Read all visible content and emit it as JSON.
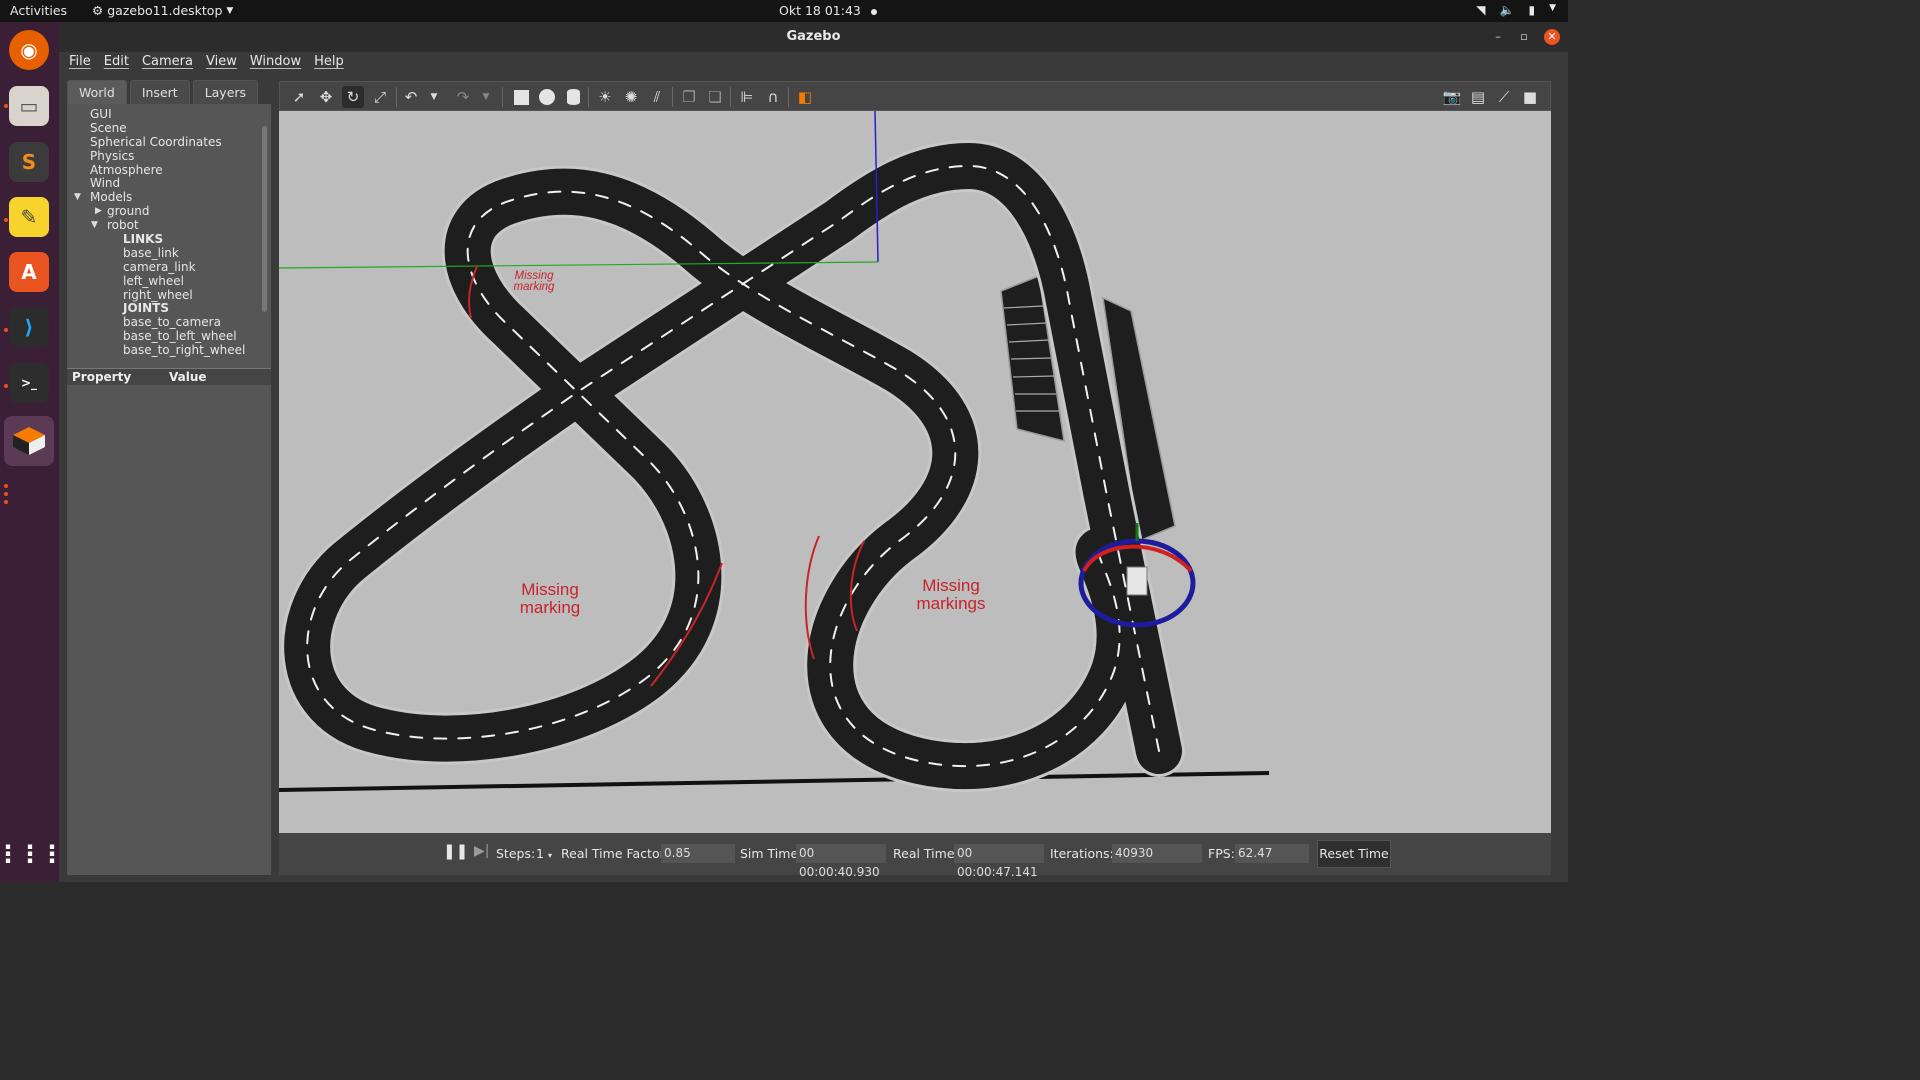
{
  "topbar": {
    "activities": "Activities",
    "app_menu": "gazebo11.desktop",
    "clock": "Okt 18  01:43"
  },
  "window": {
    "title": "Gazebo",
    "menus": [
      "File",
      "Edit",
      "Camera",
      "View",
      "Window",
      "Help"
    ]
  },
  "left_panel": {
    "tabs": [
      "World",
      "Insert",
      "Layers"
    ],
    "active_tab": "World",
    "tree": {
      "gui": "GUI",
      "scene": "Scene",
      "spherical": "Spherical Coordinates",
      "physics": "Physics",
      "atmosphere": "Atmosphere",
      "wind": "Wind",
      "models": "Models",
      "ground": "ground",
      "robot": "robot",
      "links_header": "LINKS",
      "links": [
        "base_link",
        "camera_link",
        "left_wheel",
        "right_wheel"
      ],
      "joints_header": "JOINTS",
      "joints": [
        "base_to_camera",
        "base_to_left_wheel",
        "base_to_right_wheel"
      ]
    },
    "property_header": "Property",
    "value_header": "Value"
  },
  "viewport": {
    "annotations": [
      "Missing marking",
      "Missing marking",
      "Missing markings"
    ]
  },
  "bottombar": {
    "steps_label": "Steps:",
    "steps_value": "1",
    "rtf_label": "Real Time Factor:",
    "rtf_value": "0.85",
    "simtime_label": "Sim Time:",
    "simtime_value": "00 00:00:40.930",
    "realtime_label": "Real Time:",
    "realtime_value": "00 00:00:47.141",
    "iterations_label": "Iterations:",
    "iterations_value": "40930",
    "fps_label": "FPS:",
    "fps_value": "62.47",
    "reset_label": "Reset Time"
  },
  "colors": {
    "dock_bg": "#3a1f36",
    "ubuntu_orange": "#e95420",
    "viewport_bg": "#b9b9b9",
    "track": "#1e1e1e",
    "annotation_red": "#c8232c"
  }
}
